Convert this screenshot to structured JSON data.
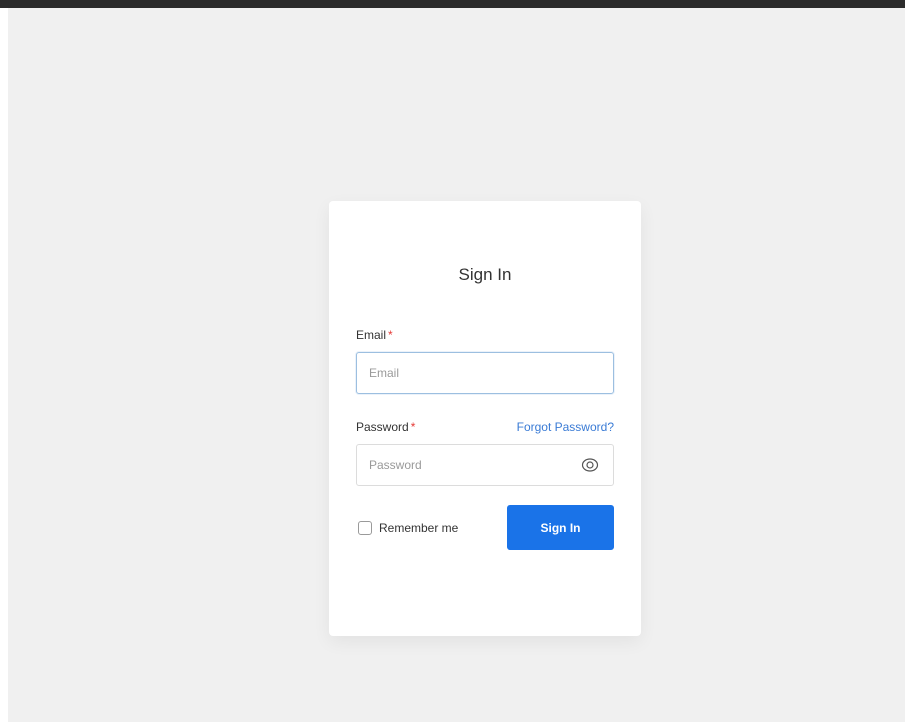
{
  "colors": {
    "accent": "#1a73e8",
    "link": "#3a7bd5",
    "required": "#e53935",
    "page_background": "#f0f0f0",
    "card_background": "#ffffff"
  },
  "form": {
    "title": "Sign In",
    "email": {
      "label": "Email",
      "required_mark": "*",
      "placeholder": "Email",
      "value": ""
    },
    "password": {
      "label": "Password",
      "required_mark": "*",
      "placeholder": "Password",
      "value": "",
      "toggle_icon": "eye-icon"
    },
    "forgot_password_label": "Forgot Password?",
    "remember_me": {
      "label": "Remember me",
      "checked": false
    },
    "submit_label": "Sign In"
  }
}
